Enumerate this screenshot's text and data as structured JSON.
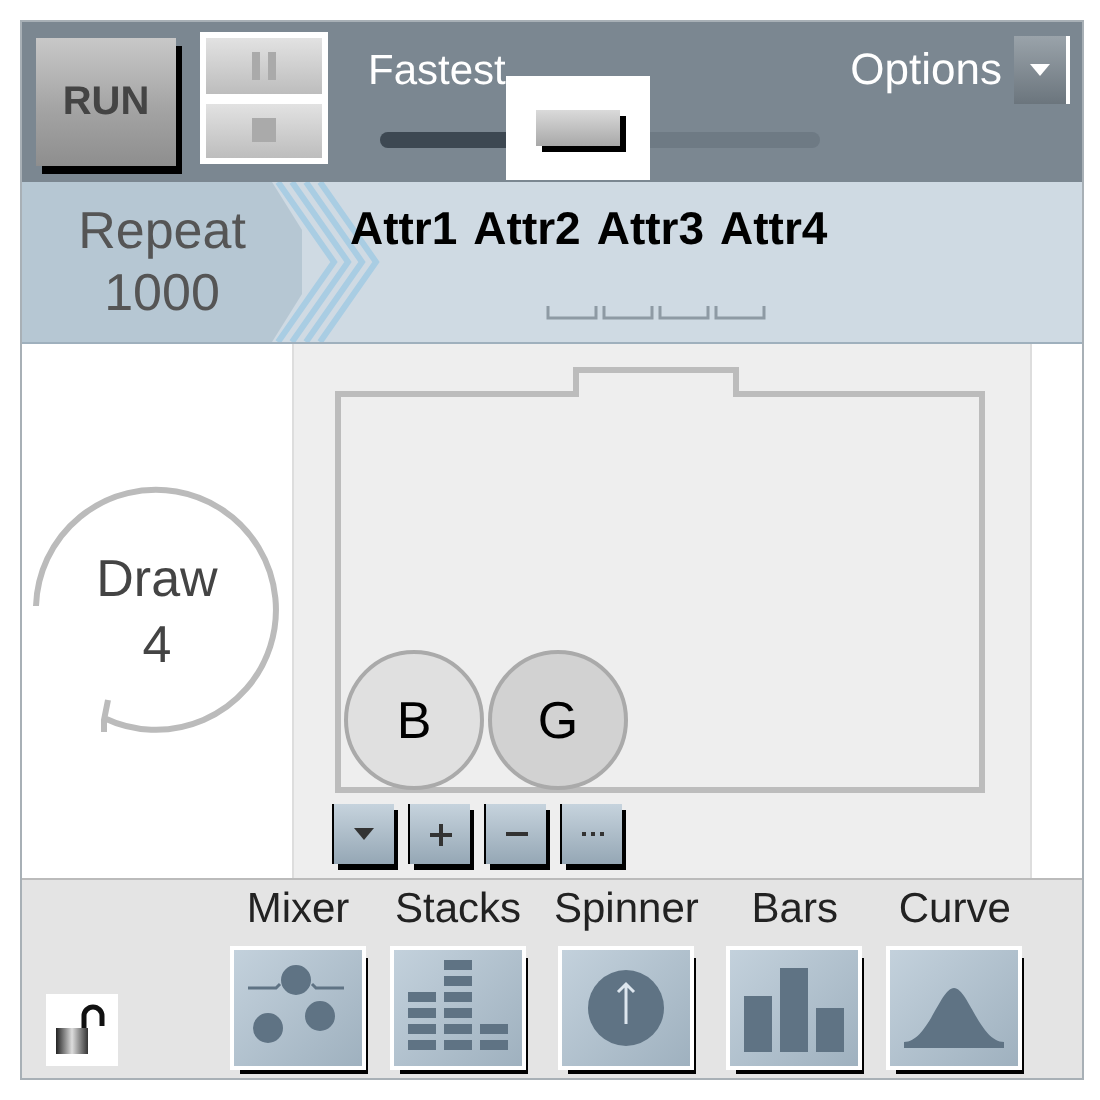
{
  "toolbar": {
    "run_label": "RUN",
    "speed": {
      "label": "Fastest",
      "level": 0.45
    },
    "options_label": "Options"
  },
  "repeat": {
    "label": "Repeat",
    "value": "1000"
  },
  "attributes": [
    {
      "label": "Attr1"
    },
    {
      "label": "Attr2"
    },
    {
      "label": "Attr3"
    },
    {
      "label": "Attr4"
    }
  ],
  "draw": {
    "label": "Draw",
    "value": "4"
  },
  "balls": [
    {
      "label": "B",
      "color": "#e0e0e0"
    },
    {
      "label": "G",
      "color": "#d2d2d2"
    }
  ],
  "devices": [
    {
      "label": "Mixer",
      "kind": "mixer"
    },
    {
      "label": "Stacks",
      "kind": "stacks"
    },
    {
      "label": "Spinner",
      "kind": "spinner"
    },
    {
      "label": "Bars",
      "kind": "bars"
    },
    {
      "label": "Curve",
      "kind": "curve"
    }
  ],
  "locked": false
}
